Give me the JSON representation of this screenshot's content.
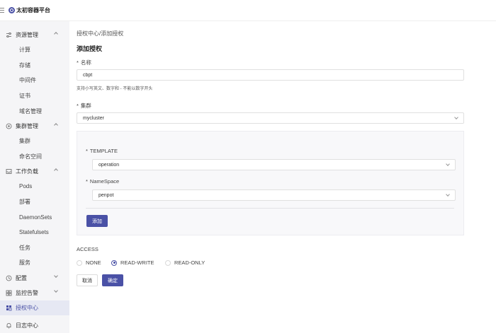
{
  "app": {
    "title": "太初容器平台"
  },
  "sidebar": {
    "groups": [
      {
        "label": "资源管理",
        "icon": "sliders-icon",
        "expanded": true,
        "items": [
          "计算",
          "存储",
          "中间件",
          "证书",
          "域名管理"
        ]
      },
      {
        "label": "集群管理",
        "icon": "cluster-icon",
        "expanded": true,
        "items": [
          "集群",
          "命名空间"
        ]
      },
      {
        "label": "工作负载",
        "icon": "inbox-icon",
        "expanded": true,
        "items": [
          "Pods",
          "部署",
          "DaemonSets",
          "Statefulsets",
          "任务",
          "服务"
        ]
      },
      {
        "label": "配置",
        "icon": "clock-icon",
        "expanded": false,
        "items": []
      },
      {
        "label": "监控告警",
        "icon": "grid-icon",
        "expanded": false,
        "items": []
      },
      {
        "label": "授权中心",
        "icon": "auth-icon",
        "expanded": false,
        "active": true,
        "items": []
      },
      {
        "label": "日志中心",
        "icon": "bell-icon",
        "expanded": false,
        "items": []
      }
    ]
  },
  "breadcrumb": "授权中心/添加授权",
  "page_title": "添加授权",
  "form": {
    "name": {
      "label": "名称",
      "value": "cbpt",
      "hint": "支持小写英文、数字和 - 不能以数字开头"
    },
    "cluster": {
      "label": "集群",
      "value": "mycluster"
    },
    "template": {
      "label": "TEMPLATE",
      "value": "operation"
    },
    "namespace": {
      "label": "NameSpace",
      "value": "penpot"
    },
    "add_label": "添加",
    "access": {
      "label": "ACCESS",
      "options": [
        "NONE",
        "READ-WRITE",
        "READ-ONLY"
      ],
      "selected": "READ-WRITE"
    },
    "cancel_label": "取消",
    "confirm_label": "确定"
  },
  "colors": {
    "primary": "#4a51a6",
    "sidebar_bg": "#f5f5f7",
    "panel_bg": "#f8f8fa"
  }
}
